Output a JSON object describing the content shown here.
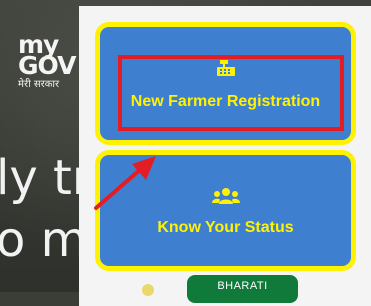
{
  "background": {
    "logo_line1": "my",
    "logo_line2": "GOV",
    "logo_tagline": "मेरी सरकार",
    "text_line1": "ly tr",
    "text_line2": "o m"
  },
  "cards": [
    {
      "label": "New Farmer Registration",
      "icon": "cash-register-icon"
    },
    {
      "label": "Know Your Status",
      "icon": "users-icon"
    }
  ],
  "bottom_badge": "BHARATI",
  "colors": {
    "card_blue": "#3e7fd0",
    "card_border": "#fff200",
    "label_yellow": "#fff200",
    "highlight_red": "#e41d24",
    "badge_green": "#0f7a3a"
  }
}
